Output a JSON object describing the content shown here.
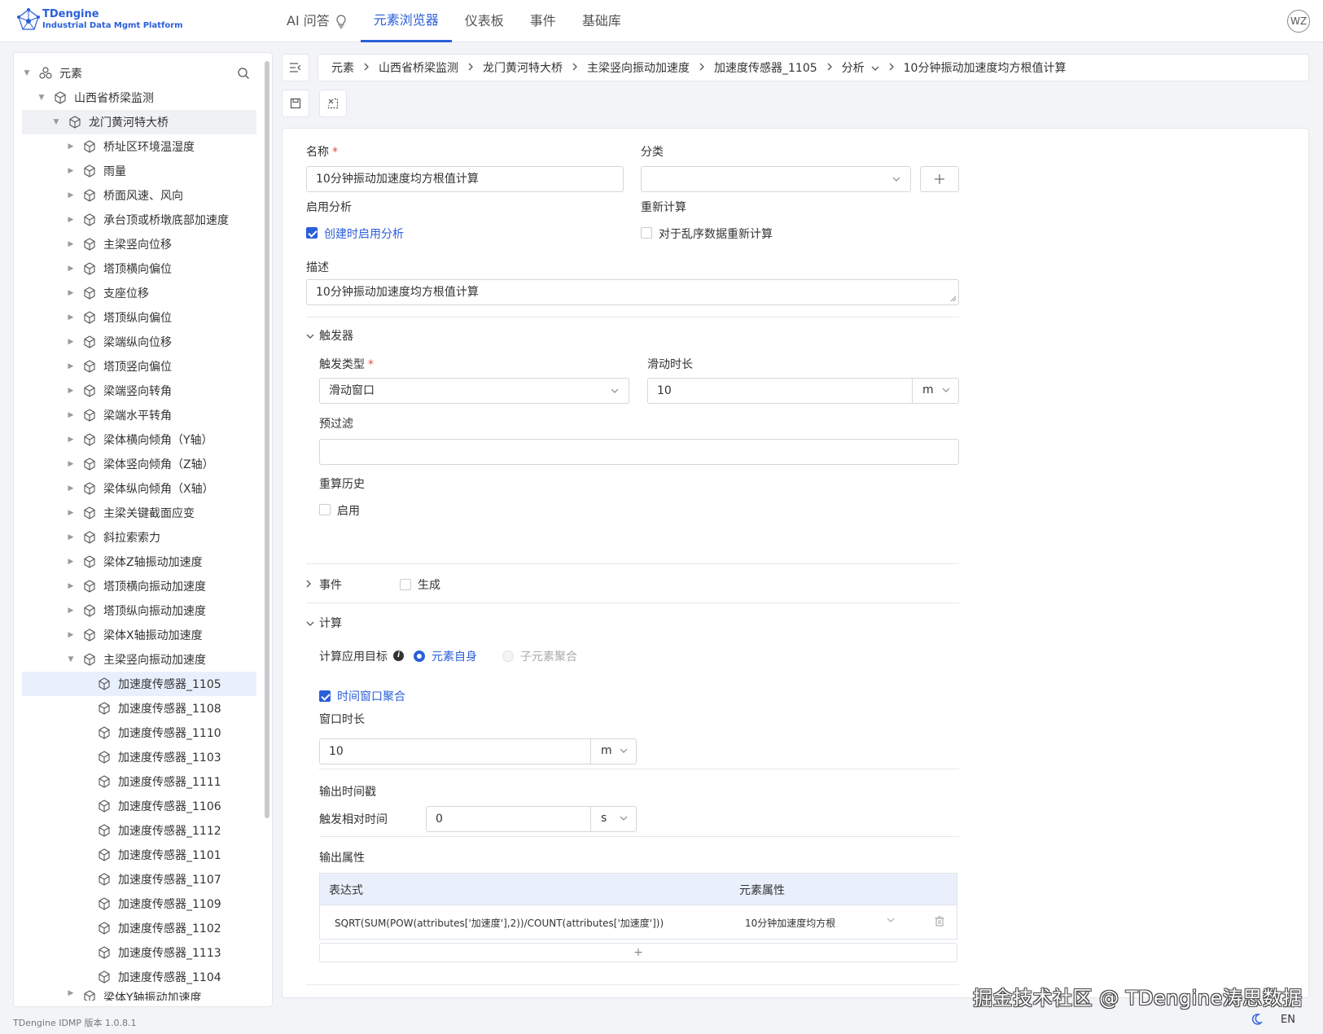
{
  "app": {
    "logo_line1": "TDengine",
    "logo_line2": "Industrial Data Mgmt Platform",
    "version": "TDengine IDMP 版本 1.0.8.1",
    "lang": "EN",
    "avatar": "WZ",
    "accent_color": "#2b5fd9"
  },
  "nav": [
    {
      "label": "AI 问答",
      "icon": "lightbulb-icon",
      "active": false
    },
    {
      "label": "元素浏览器",
      "active": true
    },
    {
      "label": "仪表板",
      "active": false
    },
    {
      "label": "事件",
      "active": false
    },
    {
      "label": "基础库",
      "active": false
    }
  ],
  "tree": {
    "root": "元素",
    "level1": "山西省桥梁监测",
    "level2": "龙门黄河特大桥",
    "children": [
      "桥址区环境温湿度",
      "雨量",
      "桥面风速、风向",
      "承台顶或桥墩底部加速度",
      "主梁竖向位移",
      "塔顶横向偏位",
      "支座位移",
      "塔顶纵向偏位",
      "梁端纵向位移",
      "塔顶竖向偏位",
      "梁端竖向转角",
      "梁端水平转角",
      "梁体横向倾角（Y轴）",
      "梁体竖向倾角（Z轴）",
      "梁体纵向倾角（X轴）",
      "主梁关键截面应变",
      "斜拉索索力",
      "梁体Z轴振动加速度",
      "塔顶横向振动加速度",
      "塔顶纵向振动加速度",
      "梁体X轴振动加速度",
      "主梁竖向振动加速度"
    ],
    "sensors": [
      "加速度传感器_1105",
      "加速度传感器_1108",
      "加速度传感器_1110",
      "加速度传感器_1103",
      "加速度传感器_1111",
      "加速度传感器_1106",
      "加速度传感器_1112",
      "加速度传感器_1101",
      "加速度传感器_1107",
      "加速度传感器_1109",
      "加速度传感器_1102",
      "加速度传感器_1113",
      "加速度传感器_1104"
    ],
    "partial_last": "梁体Y轴振动加速度"
  },
  "breadcrumb": [
    "元素",
    "山西省桥梁监测",
    "龙门黄河特大桥",
    "主梁竖向振动加速度",
    "加速度传感器_1105",
    "分析",
    "10分钟振动加速度均方根值计算"
  ],
  "form": {
    "name_label": "名称",
    "name_value": "10分钟振动加速度均方根值计算",
    "category_label": "分类",
    "category_value": "",
    "enable_label": "启用分析",
    "enable_checkbox": "创建时启用分析",
    "recalc_label": "重新计算",
    "recalc_checkbox": "对于乱序数据重新计算",
    "desc_label": "描述",
    "desc_value": "10分钟振动加速度均方根值计算",
    "trigger_section": "触发器",
    "trigger_type_label": "触发类型",
    "trigger_type_value": "滑动窗口",
    "slide_label": "滑动时长",
    "slide_value": "10",
    "slide_unit": "m",
    "prefilter_label": "预过滤",
    "prefilter_value": "",
    "history_label": "重算历史",
    "history_checkbox": "启用",
    "event_section": "事件",
    "event_checkbox": "生成",
    "calc_section": "计算",
    "target_label": "计算应用目标",
    "target_opt1": "元素自身",
    "target_opt2": "子元素聚合",
    "window_agg_checkbox": "时间窗口聚合",
    "window_len_label": "窗口时长",
    "window_len_value": "10",
    "window_len_unit": "m",
    "output_ts_label": "输出时间戳",
    "trigger_rel_label": "触发相对时间",
    "trigger_rel_value": "0",
    "trigger_rel_unit": "s",
    "output_attr_label": "输出属性",
    "table_col1": "表达式",
    "table_col2": "元素属性",
    "row_expr": "SQRT(SUM(POW(attributes['加速度'],2))/COUNT(attributes['加速度']))",
    "row_attr": "10分钟加速度均方根",
    "add_symbol": "+"
  },
  "watermark": "掘金技术社区 @ TDengine涛思数据"
}
